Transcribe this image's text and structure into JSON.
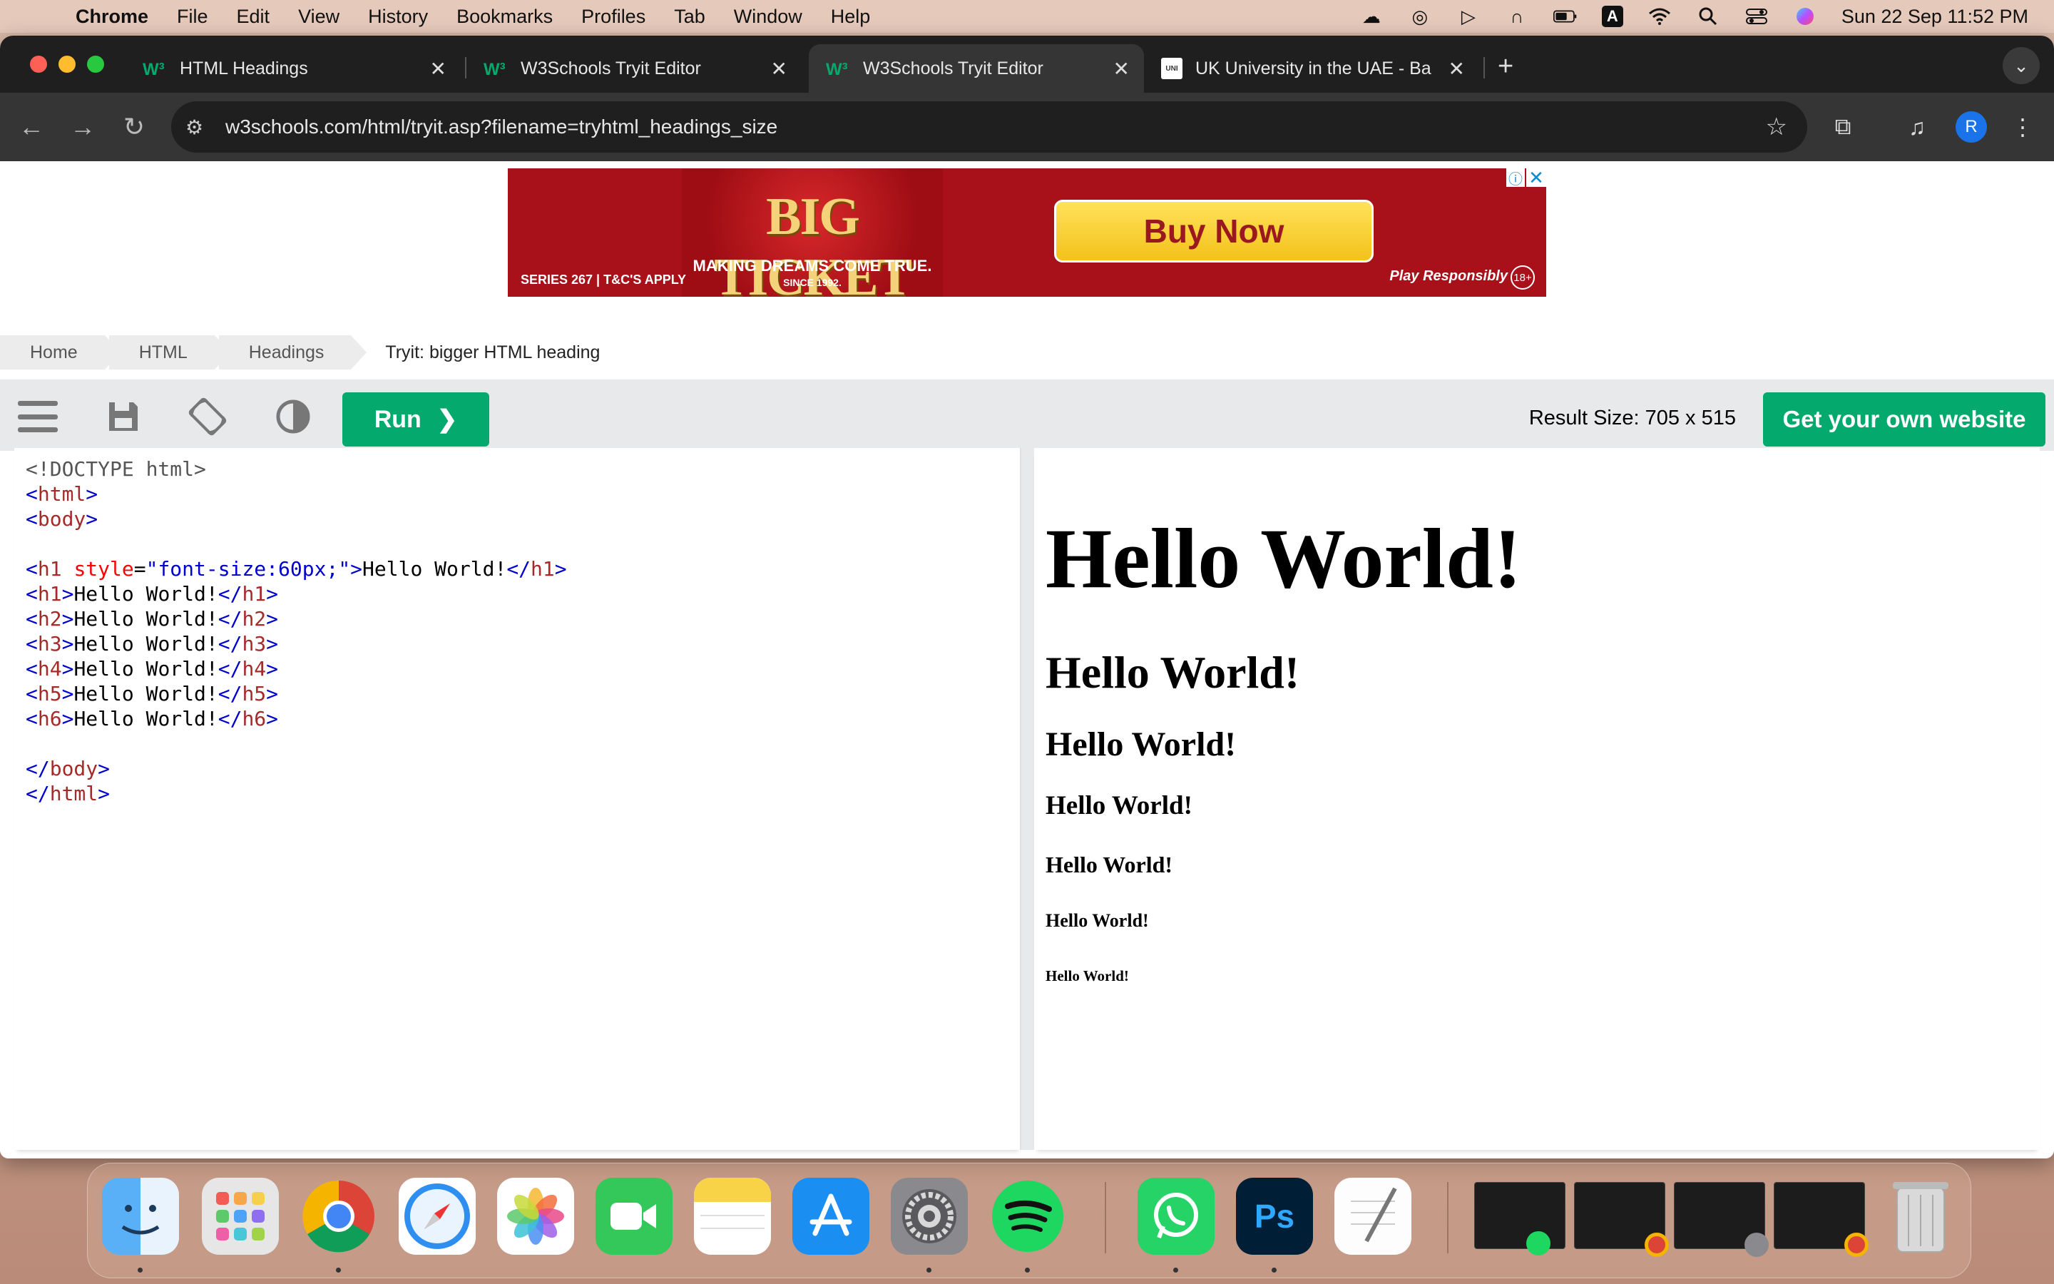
{
  "menubar": {
    "app_name": "Chrome",
    "menus": [
      "File",
      "Edit",
      "View",
      "History",
      "Bookmarks",
      "Profiles",
      "Tab",
      "Window",
      "Help"
    ],
    "input_source": "A",
    "datetime": "Sun 22 Sep  11:52 PM"
  },
  "tabs": [
    {
      "title": "HTML Headings",
      "favicon": "w3schools-icon",
      "active": false
    },
    {
      "title": "W3Schools Tryit Editor",
      "favicon": "w3schools-icon",
      "active": false
    },
    {
      "title": "W3Schools Tryit Editor",
      "favicon": "w3schools-icon",
      "active": true
    },
    {
      "title": "UK University in the UAE - Ba",
      "favicon": "university-icon",
      "active": false
    }
  ],
  "address_bar": {
    "url": "w3schools.com/html/tryit.asp?filename=tryhtml_headings_size"
  },
  "profile_initial": "R",
  "ad": {
    "brand": "BIG TICKET",
    "tagline": "MAKING DREAMS COME TRUE.",
    "since": "SINCE 1992.",
    "series": "SERIES 267  |  T&C'S APPLY",
    "cta": "Buy Now",
    "play_responsibly": "Play Responsibly",
    "age": "18+"
  },
  "breadcrumb": [
    "Home",
    "HTML",
    "Headings",
    "Tryit: bigger HTML heading"
  ],
  "editor": {
    "run_label": "Run",
    "result_size": "Result Size: 705 x 515",
    "own_website_label": "Get your own website",
    "code": [
      "<!DOCTYPE html>",
      "<html>",
      "<body>",
      "",
      "<h1 style=\"font-size:60px;\">Hello World!</h1>",
      "<h1>Hello World!</h1>",
      "<h2>Hello World!</h2>",
      "<h3>Hello World!</h3>",
      "<h4>Hello World!</h4>",
      "<h5>Hello World!</h5>",
      "<h6>Hello World!</h6>",
      "",
      "</body>",
      "</html>"
    ]
  },
  "result": {
    "headings": [
      {
        "level": "h1-60px",
        "text": "Hello World!"
      },
      {
        "level": "h1",
        "text": "Hello World!"
      },
      {
        "level": "h2",
        "text": "Hello World!"
      },
      {
        "level": "h3",
        "text": "Hello World!"
      },
      {
        "level": "h4",
        "text": "Hello World!"
      },
      {
        "level": "h5",
        "text": "Hello World!"
      },
      {
        "level": "h6",
        "text": "Hello World!"
      }
    ]
  },
  "dock": {
    "apps": [
      "finder-icon",
      "launchpad-icon",
      "chrome-icon",
      "safari-icon",
      "photos-icon",
      "facetime-icon",
      "notes-icon",
      "app-store-icon",
      "system-settings-icon",
      "spotify-icon",
      "whatsapp-icon",
      "photoshop-icon",
      "textedit-icon",
      "trash-icon"
    ],
    "photoshop_label": "Ps"
  },
  "colors": {
    "accent_green": "#04aa6d",
    "code_tag": "#0000cd",
    "code_tagname": "#a52a2a",
    "code_attr": "#ff0000"
  }
}
